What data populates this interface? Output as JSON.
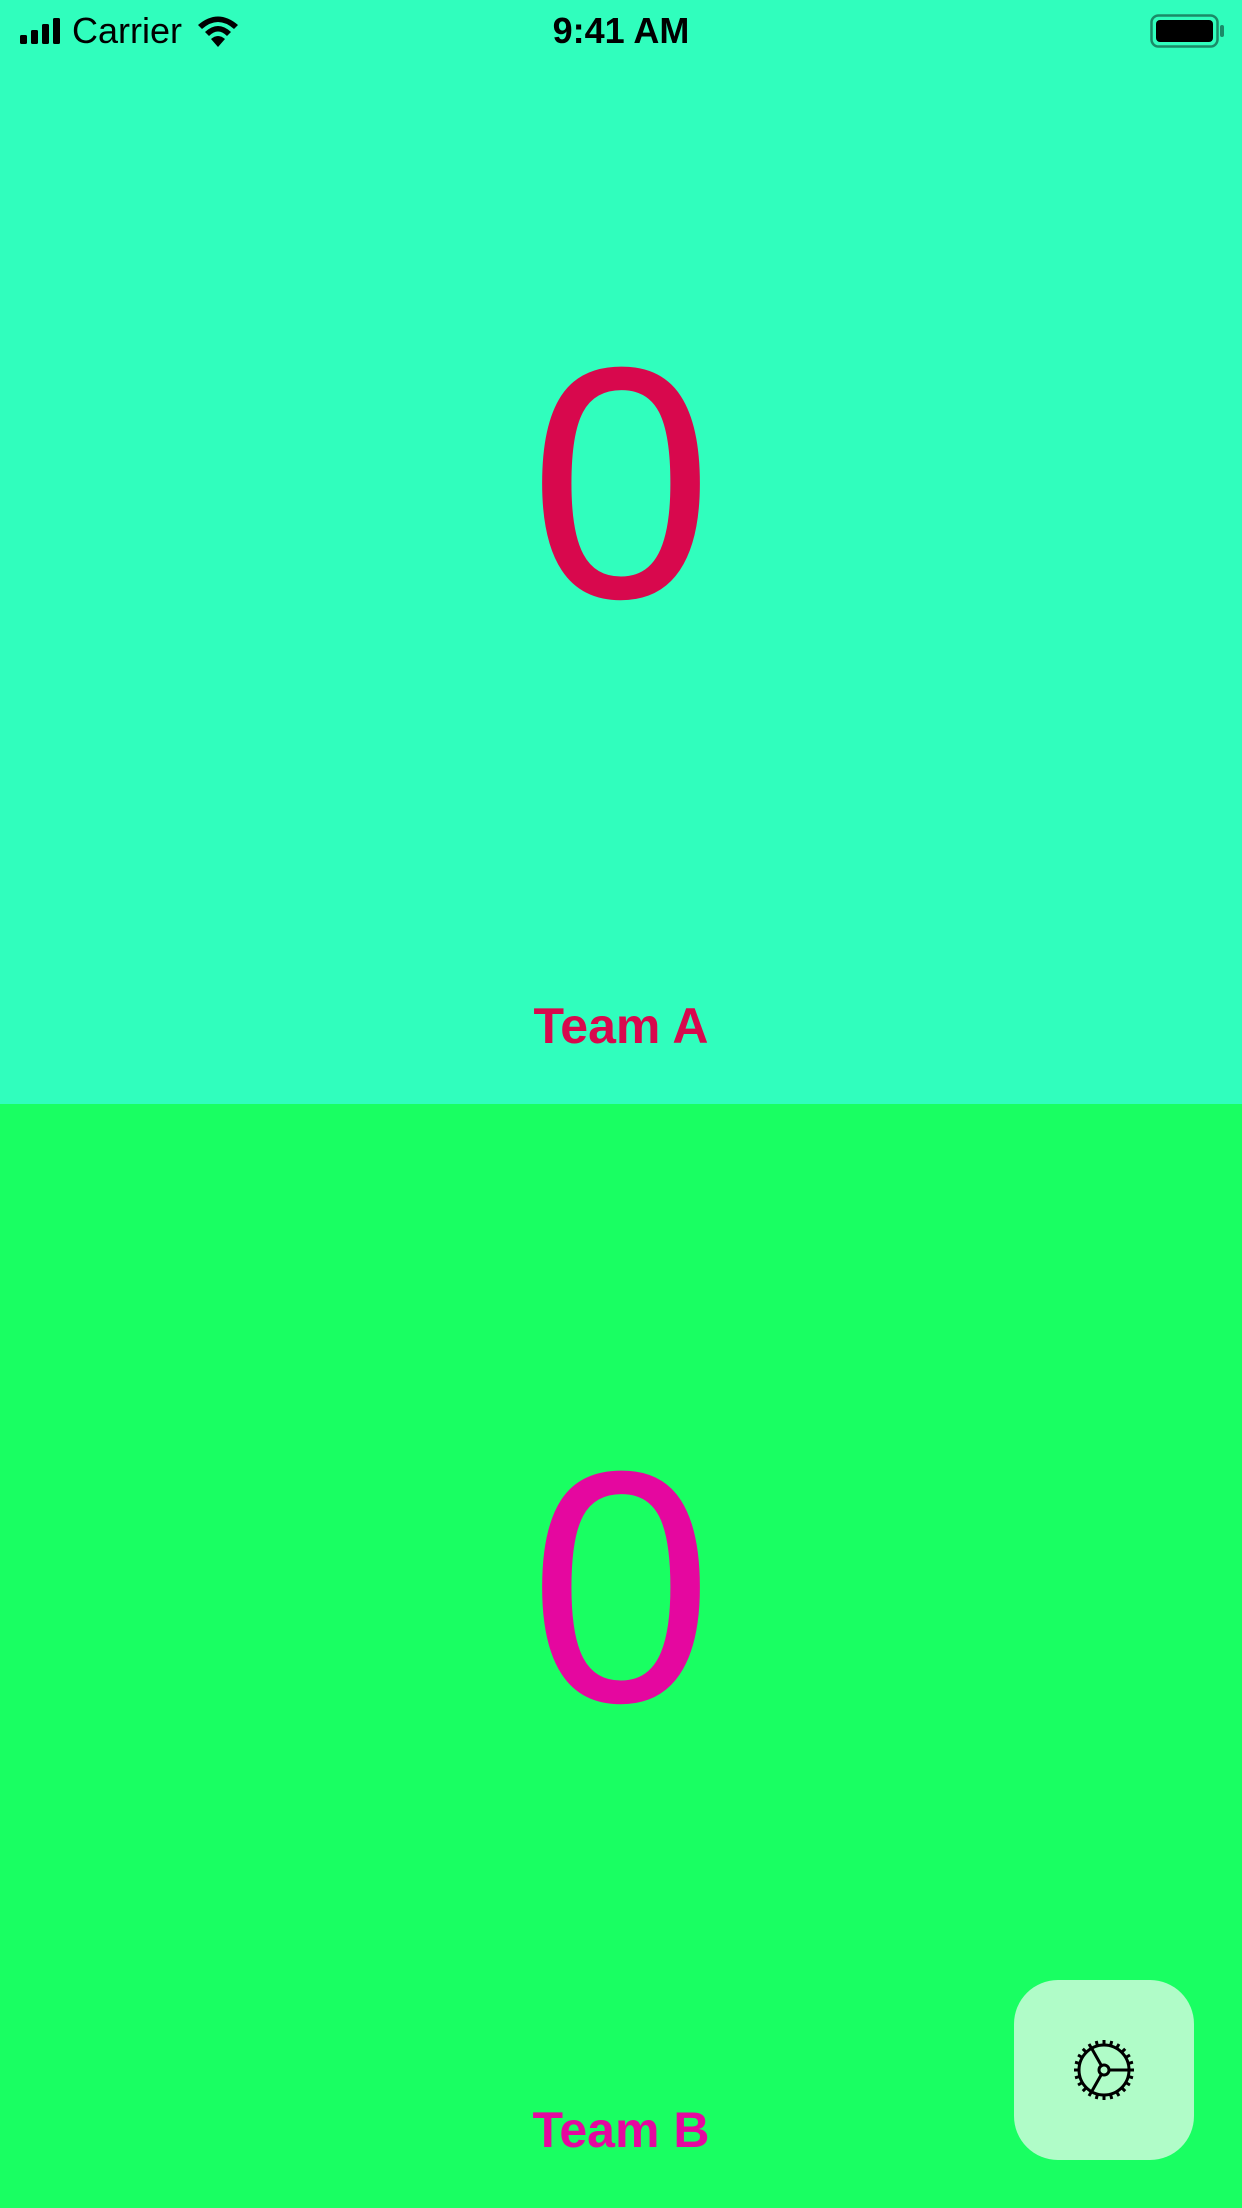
{
  "status_bar": {
    "carrier": "Carrier",
    "time": "9:41 AM"
  },
  "team_a": {
    "score": "0",
    "name": "Team A",
    "background": "#30FEBD",
    "text_color": "#D8084D"
  },
  "team_b": {
    "score": "0",
    "name": "Team B",
    "background": "#19FF62",
    "text_color": "#E5079F"
  },
  "settings": {
    "icon": "gear-icon",
    "background": "#B0FCC8"
  }
}
